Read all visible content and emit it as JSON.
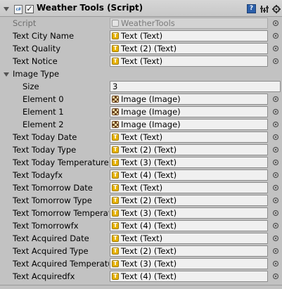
{
  "component": {
    "title": "Weather Tools (Script)",
    "script_icon_text": "c#",
    "help_icon_text": "?"
  },
  "script_field": {
    "label": "Script",
    "value": "WeatherTools"
  },
  "properties_top": [
    {
      "label": "Text City Name",
      "value": "Text (Text)"
    },
    {
      "label": "Text Quality",
      "value": "Text (2) (Text)"
    },
    {
      "label": "Text Notice",
      "value": "Text (Text)"
    }
  ],
  "image_type": {
    "label": "Image Type",
    "size_label": "Size",
    "size_value": "3",
    "elements": [
      {
        "label": "Element 0",
        "value": "Image (Image)"
      },
      {
        "label": "Element 1",
        "value": "Image (Image)"
      },
      {
        "label": "Element 2",
        "value": "Image (Image)"
      }
    ]
  },
  "properties_bottom": [
    {
      "label": "Text Today Date",
      "value": "Text (Text)"
    },
    {
      "label": "Text Today Type",
      "value": "Text (2) (Text)"
    },
    {
      "label": "Text Today Temperature",
      "value": "Text (3) (Text)"
    },
    {
      "label": "Text Todayfx",
      "value": "Text (4) (Text)"
    },
    {
      "label": "Text Tomorrow Date",
      "value": "Text (Text)"
    },
    {
      "label": "Text Tomorrow Type",
      "value": "Text (2) (Text)"
    },
    {
      "label": "Text Tomorrow Temperature",
      "value": "Text (3) (Text)"
    },
    {
      "label": "Text Tomorrowfx",
      "value": "Text (4) (Text)"
    },
    {
      "label": "Text Acquired Date",
      "value": "Text (Text)"
    },
    {
      "label": "Text Acquired Type",
      "value": "Text (2) (Text)"
    },
    {
      "label": "Text Acquired Temperature",
      "value": "Text (3) (Text)"
    },
    {
      "label": "Text Acquiredfx",
      "value": "Text (4) (Text)"
    }
  ],
  "icons": {
    "text_component": "text-component-icon",
    "image_component": "image-component-icon",
    "object_picker": "object-picker-icon"
  },
  "colors": {
    "panel_bg": "#c2c2c2",
    "help_blue": "#2b5faa",
    "text_icon_yellow": "#e7b200"
  }
}
